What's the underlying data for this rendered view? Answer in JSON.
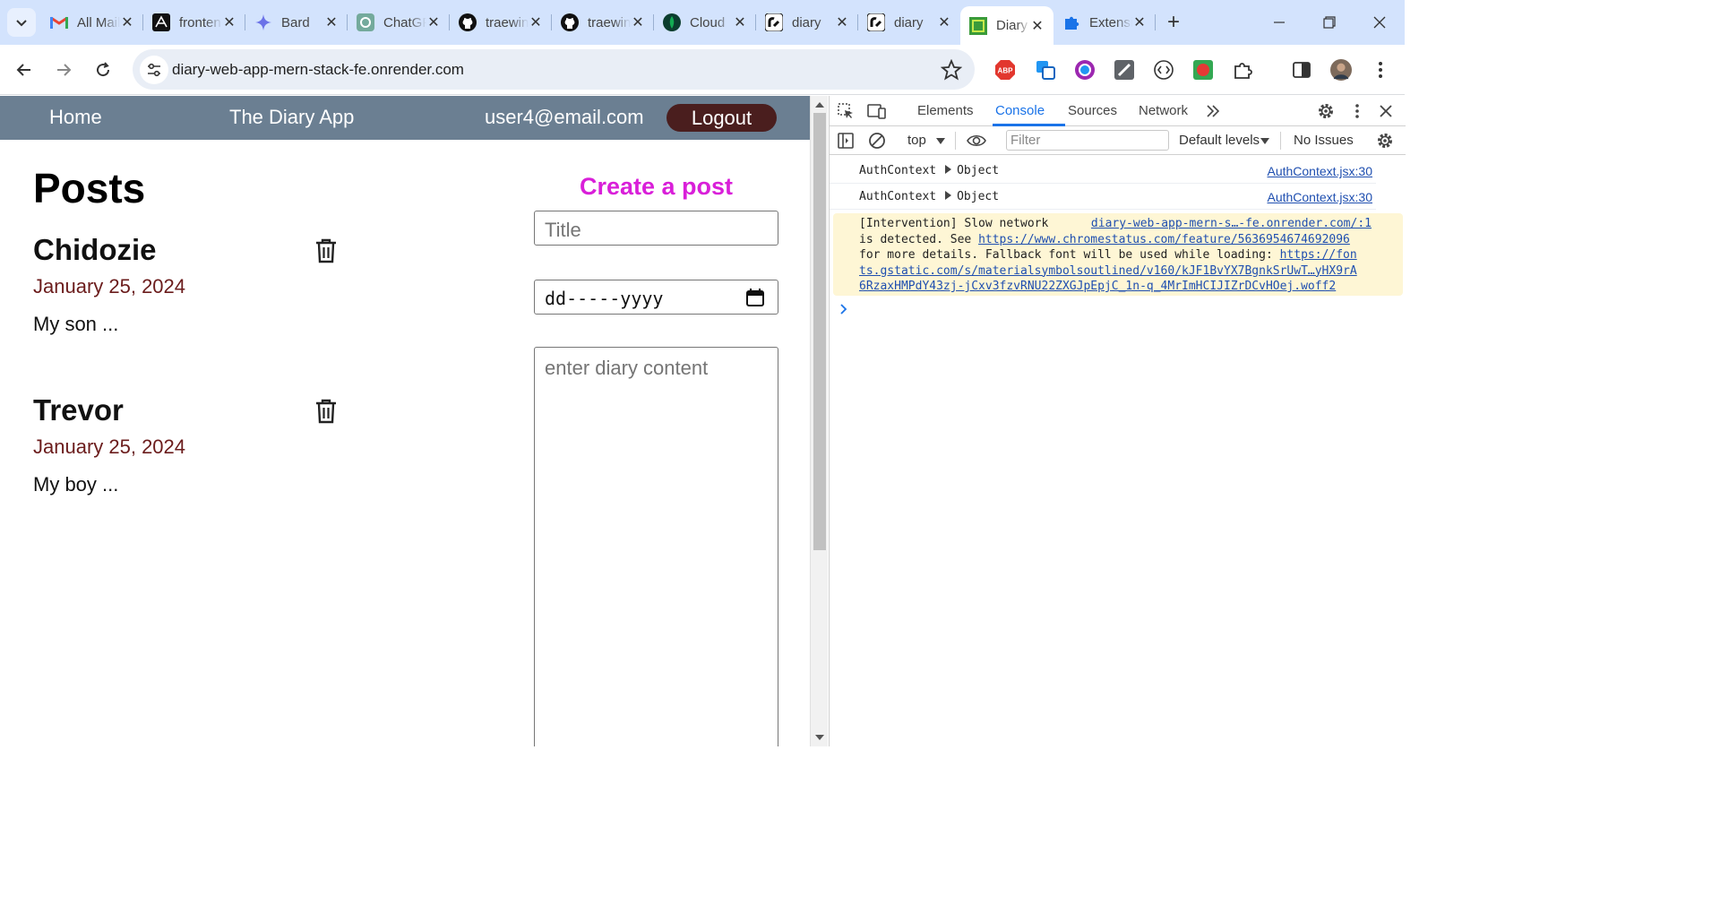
{
  "browser": {
    "tabs": [
      {
        "title": "All Mail",
        "icon": "gmail-icon"
      },
      {
        "title": "frontend",
        "icon": "app-icon"
      },
      {
        "title": "Bard",
        "icon": "bard-icon"
      },
      {
        "title": "ChatGPT",
        "icon": "chatgpt-icon"
      },
      {
        "title": "traewin",
        "icon": "github-icon"
      },
      {
        "title": "traewin",
        "icon": "github-icon"
      },
      {
        "title": "Cloud",
        "icon": "mongodb-icon"
      },
      {
        "title": "diary",
        "icon": "render-icon"
      },
      {
        "title": "diary",
        "icon": "render-icon"
      },
      {
        "title": "Diary",
        "icon": "diary-icon",
        "active": true
      },
      {
        "title": "Extensions",
        "icon": "puzzle-icon"
      }
    ],
    "url": "diary-web-app-mern-stack-fe.onrender.com"
  },
  "app": {
    "nav": {
      "home": "Home",
      "title": "The Diary App",
      "user": "user4@email.com",
      "logout": "Logout"
    },
    "posts_heading": "Posts",
    "posts": [
      {
        "title": "Chidozie",
        "date": "January 25, 2024",
        "excerpt": "My son ..."
      },
      {
        "title": "Trevor",
        "date": "January 25, 2024",
        "excerpt": "My boy ..."
      }
    ],
    "create": {
      "heading": "Create a post",
      "title_placeholder": "Title",
      "date_placeholder": "dd-----yyyy",
      "content_placeholder": "enter diary content"
    }
  },
  "devtools": {
    "tabs": [
      "Elements",
      "Console",
      "Sources",
      "Network"
    ],
    "active_tab": "Console",
    "context": "top",
    "filter_placeholder": "Filter",
    "levels": "Default levels",
    "issues": "No Issues",
    "logs": [
      {
        "label": "AuthContext",
        "value": "Object",
        "source": "AuthContext.jsx:30"
      },
      {
        "label": "AuthContext",
        "value": "Object",
        "source": "AuthContext.jsx:30"
      }
    ],
    "warning": {
      "text1": "[Intervention] Slow network",
      "source": "diary-web-app-mern-s…-fe.onrender.com/:1",
      "text2": "is detected. See",
      "link1": "https://www.chromestatus.com/feature/5636954674692096",
      "text3": "for more details. Fallback font will be used while loading:",
      "link2a": "https://fon",
      "link2b": "ts.gstatic.com/s/materialsymbolsoutlined/v160/kJF1BvYX7BgnkSrUwT…yHX9rA",
      "link2c": "6RzaxHMPdY43zj-jCxv3fzvRNU22ZXGJpEpjC_1n-q_4MrImHCIJIZrDCvHOej.woff2"
    }
  }
}
